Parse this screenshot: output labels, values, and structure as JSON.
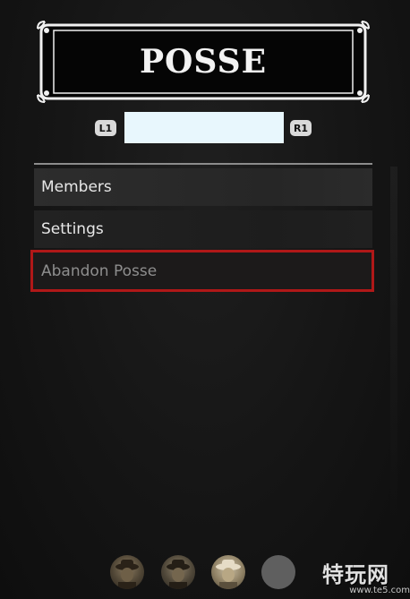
{
  "header": {
    "title": "POSSE"
  },
  "tabs": {
    "left_button": "L1",
    "right_button": "R1",
    "selected_tab_label": ""
  },
  "menu": {
    "items": [
      {
        "label": "Members",
        "state": "normal"
      },
      {
        "label": "Settings",
        "state": "normal"
      },
      {
        "label": "Abandon Posse",
        "state": "selected-disabled"
      }
    ]
  },
  "members_bar": {
    "avatars": [
      "avatar-player-1",
      "avatar-player-2",
      "avatar-player-3",
      "avatar-empty-slot"
    ]
  },
  "watermark": {
    "brand": "特玩网",
    "url": "www.te5.com"
  },
  "colors": {
    "highlight_border": "#b01818",
    "text_primary": "#e8e8e8",
    "text_disabled": "#8e8e8e"
  }
}
